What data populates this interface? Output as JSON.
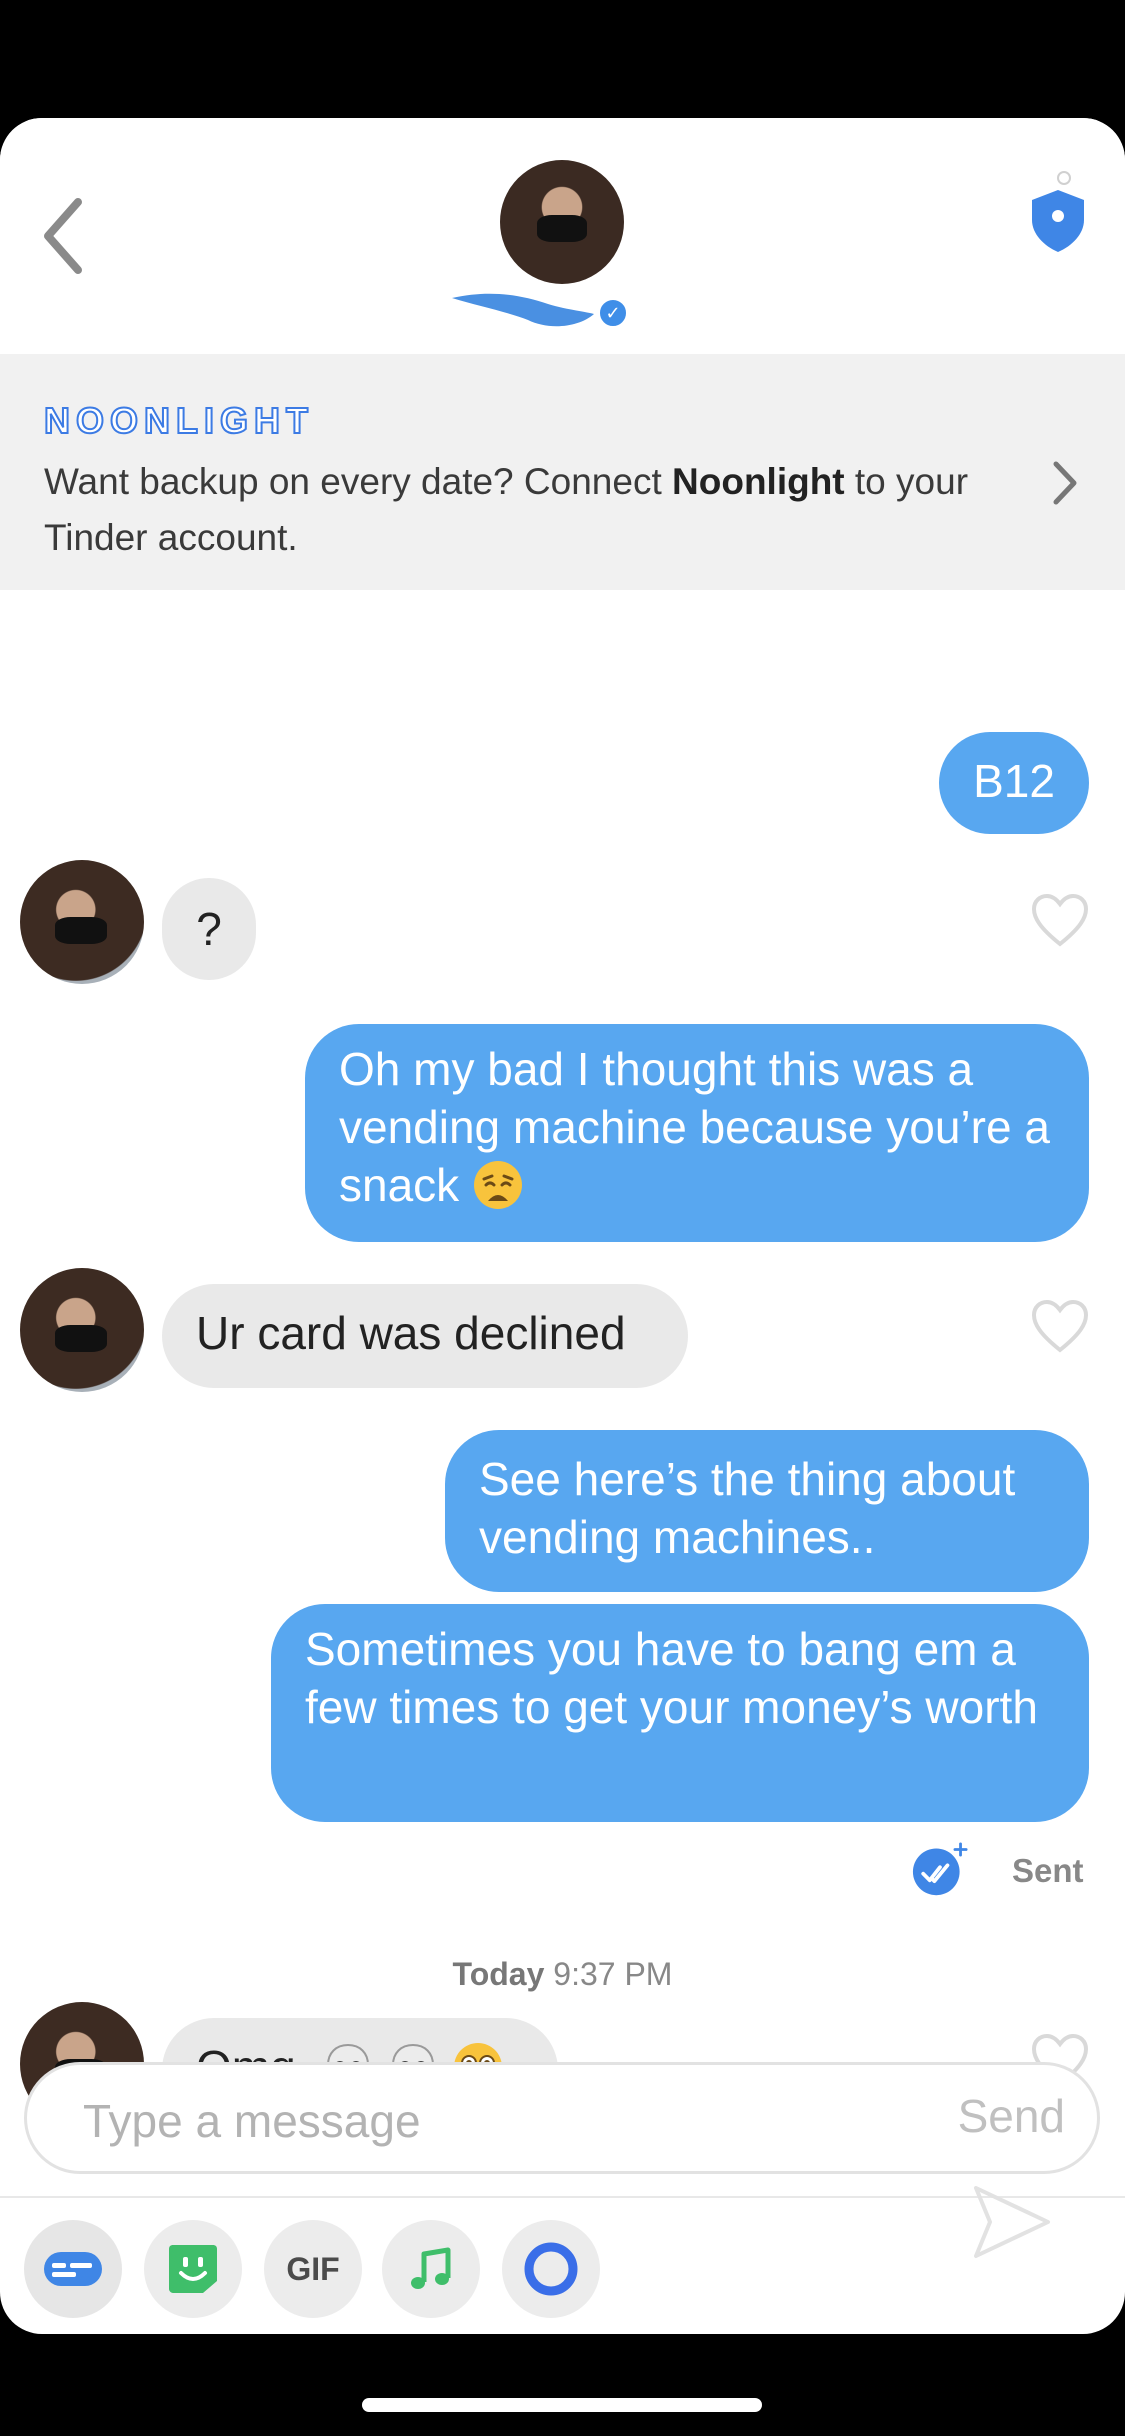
{
  "header": {
    "back_label": "",
    "avatar": "match-avatar",
    "safety_icon": "shield-icon"
  },
  "banner": {
    "brand": "NOONLIGHT",
    "text_before": "Want backup on every date? Connect ",
    "text_bold": "Noonlight",
    "text_after": " to your Tinder account."
  },
  "messages": [
    {
      "from": "me",
      "text": "B12"
    },
    {
      "from": "them",
      "text": "?"
    },
    {
      "from": "me",
      "text": "Oh my bad I thought this was a vending machine because you’re a snack"
    },
    {
      "from": "them",
      "text": "Ur card was declined"
    },
    {
      "from": "me",
      "text": "See here’s the thing about vending machines.."
    },
    {
      "from": "me",
      "text": "Sometimes you have to bang em a few times to get your money’s worth"
    },
    {
      "from": "them",
      "text": "Omg"
    }
  ],
  "status": {
    "sent_label": "Sent"
  },
  "timestamp": {
    "day": "Today",
    "time": "9:37 PM"
  },
  "composer": {
    "placeholder": "Type a message",
    "send_label": "Send"
  },
  "toolbar": {
    "gif_label": "GIF",
    "icons": [
      "messages-icon",
      "sticker-icon",
      "gif-icon",
      "music-icon",
      "loop-icon"
    ]
  },
  "colors": {
    "outgoing_bubble": "#58a7f0",
    "incoming_bubble": "#e9e9e9",
    "brand_blue": "#3c7be4"
  }
}
